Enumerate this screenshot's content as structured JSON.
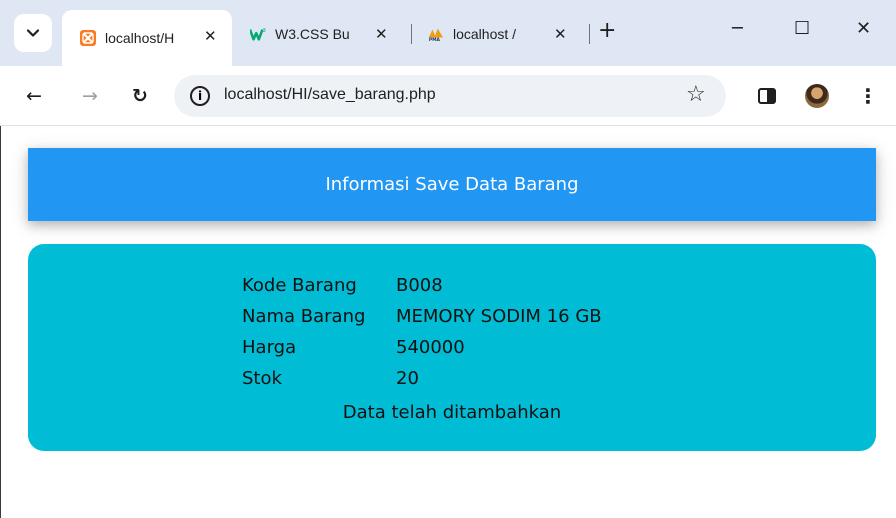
{
  "browser": {
    "tabs": [
      {
        "title": "localhost/H",
        "icon": "xampp-icon",
        "active": true
      },
      {
        "title": "W3.CSS Bu",
        "icon": "w3schools-icon",
        "active": false
      },
      {
        "title": "localhost /",
        "icon": "phpmyadmin-icon",
        "active": false
      }
    ],
    "address_bar": {
      "url": "localhost/HI/save_barang.php"
    }
  },
  "page": {
    "header_title": "Informasi Save Data Barang",
    "fields": [
      {
        "label": "Kode Barang",
        "value": "B008"
      },
      {
        "label": "Nama Barang",
        "value": "MEMORY SODIM 16 GB"
      },
      {
        "label": "Harga",
        "value": "540000"
      },
      {
        "label": "Stok",
        "value": "20"
      }
    ],
    "status_message": "Data telah ditambahkan"
  },
  "colors": {
    "header_bg": "#2196f3",
    "panel_bg": "#00bcd4",
    "tabbar_bg": "#dfe7f5"
  }
}
